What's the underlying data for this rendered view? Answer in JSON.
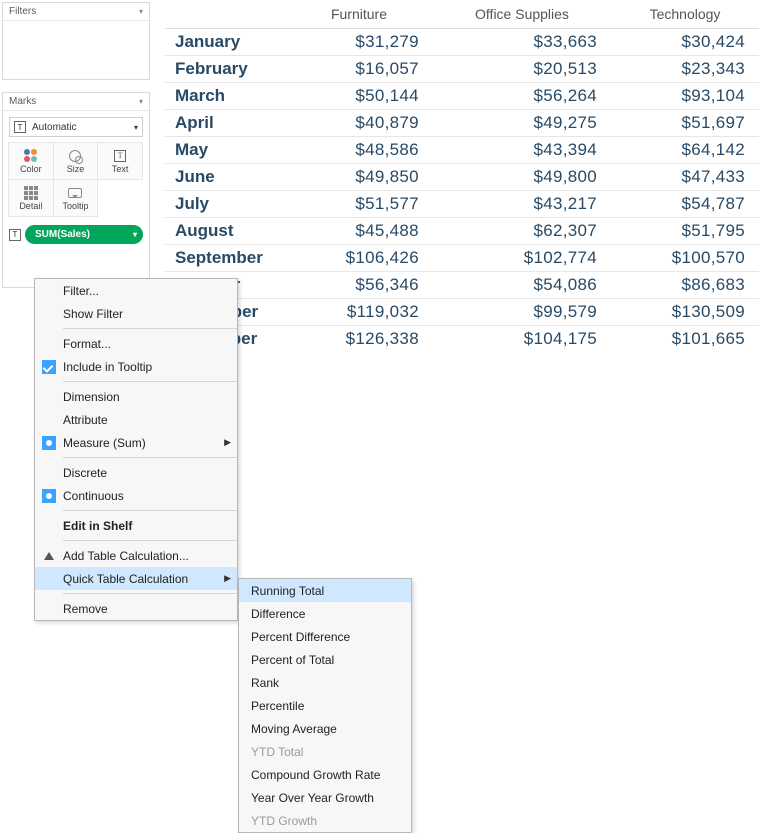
{
  "filters_panel": {
    "title": "Filters"
  },
  "marks_panel": {
    "title": "Marks",
    "select_label": "Automatic",
    "cells": [
      {
        "name": "color",
        "label": "Color"
      },
      {
        "name": "size",
        "label": "Size"
      },
      {
        "name": "text",
        "label": "Text"
      },
      {
        "name": "detail",
        "label": "Detail"
      },
      {
        "name": "tooltip",
        "label": "Tooltip"
      }
    ]
  },
  "pill": {
    "label": "SUM(Sales)"
  },
  "table": {
    "columns": [
      "Furniture",
      "Office Supplies",
      "Technology"
    ],
    "rows": [
      {
        "month": "January",
        "vals": [
          "$31,279",
          "$33,663",
          "$30,424"
        ]
      },
      {
        "month": "February",
        "vals": [
          "$16,057",
          "$20,513",
          "$23,343"
        ]
      },
      {
        "month": "March",
        "vals": [
          "$50,144",
          "$56,264",
          "$93,104"
        ]
      },
      {
        "month": "April",
        "vals": [
          "$40,879",
          "$49,275",
          "$51,697"
        ]
      },
      {
        "month": "May",
        "vals": [
          "$48,586",
          "$43,394",
          "$64,142"
        ]
      },
      {
        "month": "June",
        "vals": [
          "$49,850",
          "$49,800",
          "$47,433"
        ]
      },
      {
        "month": "July",
        "vals": [
          "$51,577",
          "$43,217",
          "$54,787"
        ]
      },
      {
        "month": "August",
        "vals": [
          "$45,488",
          "$62,307",
          "$51,795"
        ]
      },
      {
        "month": "September",
        "vals": [
          "$106,426",
          "$102,774",
          "$100,570"
        ]
      },
      {
        "month": "October",
        "vals": [
          "$56,346",
          "$54,086",
          "$86,683"
        ]
      },
      {
        "month": "November",
        "vals": [
          "$119,032",
          "$99,579",
          "$130,509"
        ]
      },
      {
        "month": "December",
        "vals": [
          "$126,338",
          "$104,175",
          "$101,665"
        ]
      }
    ]
  },
  "context_menu": {
    "items": [
      {
        "label": "Filter...",
        "icon": null
      },
      {
        "label": "Show Filter",
        "icon": null
      },
      {
        "sep": true
      },
      {
        "label": "Format...",
        "icon": null
      },
      {
        "label": "Include in Tooltip",
        "icon": "check"
      },
      {
        "sep": true
      },
      {
        "label": "Dimension",
        "icon": null
      },
      {
        "label": "Attribute",
        "icon": null
      },
      {
        "label": "Measure (Sum)",
        "icon": "dot",
        "arrow": true
      },
      {
        "sep": true
      },
      {
        "label": "Discrete",
        "icon": null
      },
      {
        "label": "Continuous",
        "icon": "dot"
      },
      {
        "sep": true
      },
      {
        "label": "Edit in Shelf",
        "icon": null,
        "bold": true
      },
      {
        "sep": true
      },
      {
        "label": "Add Table Calculation...",
        "icon": "tri"
      },
      {
        "label": "Quick Table Calculation",
        "icon": null,
        "arrow": true,
        "hl": true
      },
      {
        "sep": true
      },
      {
        "label": "Remove",
        "icon": null
      }
    ]
  },
  "submenu": {
    "items": [
      {
        "label": "Running Total",
        "hl": true
      },
      {
        "label": "Difference"
      },
      {
        "label": "Percent Difference"
      },
      {
        "label": "Percent of Total"
      },
      {
        "label": "Rank"
      },
      {
        "label": "Percentile"
      },
      {
        "label": "Moving Average"
      },
      {
        "label": "YTD Total",
        "disabled": true
      },
      {
        "label": "Compound Growth Rate"
      },
      {
        "label": "Year Over Year Growth"
      },
      {
        "label": "YTD Growth",
        "disabled": true
      }
    ]
  }
}
